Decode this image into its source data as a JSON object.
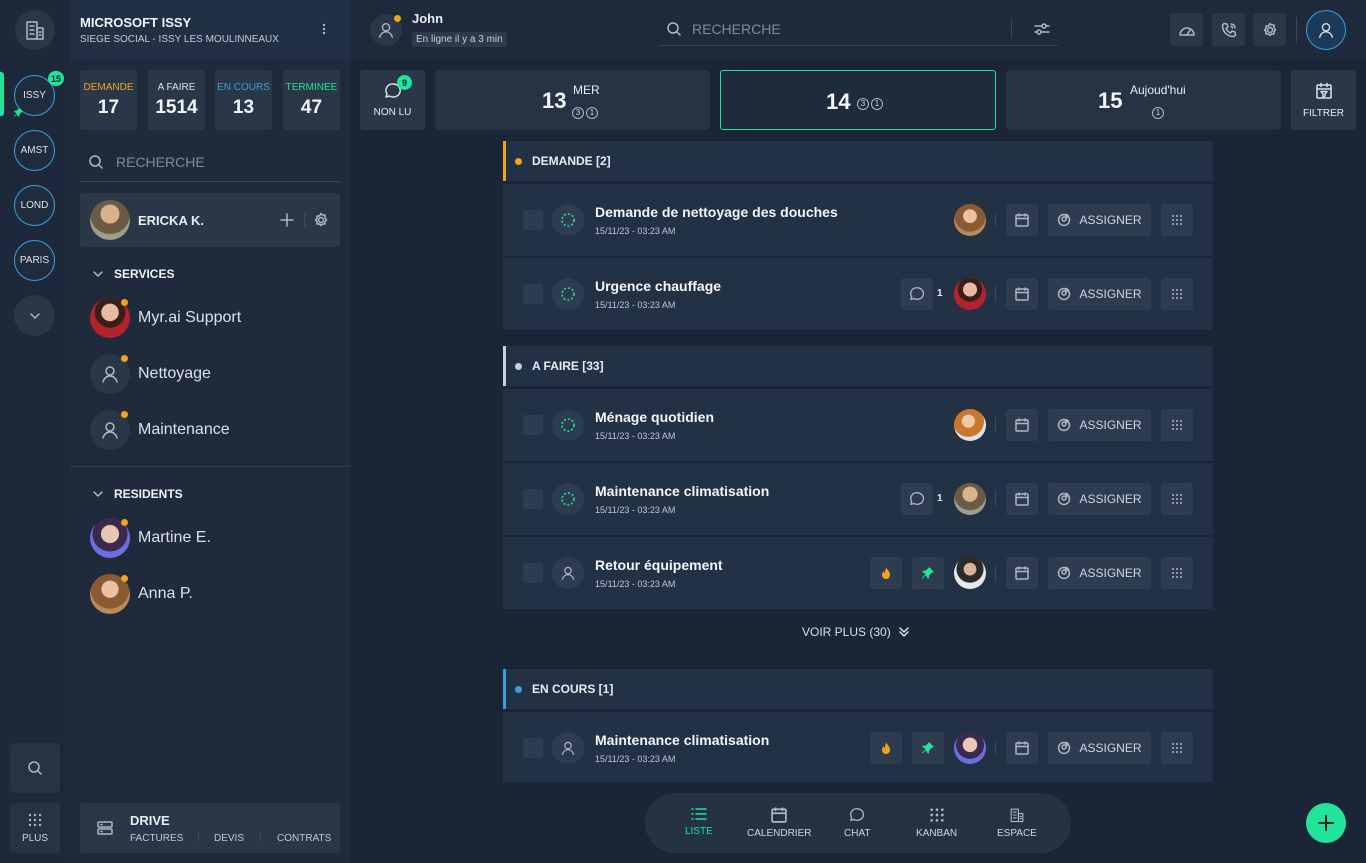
{
  "org": {
    "name": "MICROSOFT ISSY",
    "subtitle": "SIEGE SOCIAL - ISSY LES MOULINNEAUX"
  },
  "rail": {
    "sites": [
      {
        "label": "ISSY",
        "badge": "15",
        "active": true
      },
      {
        "label": "AMST"
      },
      {
        "label": "LOND"
      },
      {
        "label": "PARIS"
      }
    ],
    "plus_label": "PLUS"
  },
  "stats": [
    {
      "label": "DEMANDE",
      "value": "17",
      "color": "#f6a21e"
    },
    {
      "label": "A FAIRE",
      "value": "1514",
      "color": "#dbe1e8"
    },
    {
      "label": "EN COURS",
      "value": "13",
      "color": "#3a9fe0"
    },
    {
      "label": "TERMINEE",
      "value": "47",
      "color": "#21e39a"
    }
  ],
  "sidebar": {
    "search_placeholder": "RECHERCHE",
    "user": "ERICKA K.",
    "services_title": "SERVICES",
    "services": [
      "Myr.ai Support",
      "Nettoyage",
      "Maintenance"
    ],
    "residents_title": "RESIDENTS",
    "residents": [
      "Martine E.",
      "Anna P."
    ]
  },
  "drive": {
    "title": "DRIVE",
    "links": [
      "FACTURES",
      "DEVIS",
      "CONTRATS"
    ]
  },
  "topbar": {
    "user_name": "John",
    "user_status": "En ligne il y a 3 min",
    "search_placeholder": "RECHERCHE"
  },
  "nonlu": {
    "label": "NON LU",
    "badge": "9"
  },
  "days": [
    {
      "num": "13",
      "name": "MER",
      "counts": [
        "3",
        "1"
      ]
    },
    {
      "num": "14",
      "name": "",
      "counts": [
        "3",
        "1"
      ],
      "selected": true
    },
    {
      "num": "15",
      "name": "Aujoud'hui",
      "counts": [
        "1"
      ]
    }
  ],
  "filter_label": "FILTRER",
  "groups": {
    "demande": {
      "title": "DEMANDE [2]",
      "color": "#f6a21e"
    },
    "afaire": {
      "title": "A FAIRE [33]",
      "color": "#c8d0da"
    },
    "encours": {
      "title": "EN COURS [1]",
      "color": "#3a9fe0"
    }
  },
  "assign_label": "ASSIGNER",
  "tasks": [
    {
      "title": "Demande de nettoyage des douches",
      "date": "15/11/23 - 03:23 AM"
    },
    {
      "title": "Urgence chauffage",
      "date": "15/11/23 - 03:23 AM",
      "comments": "1"
    },
    {
      "title": "Ménage quotidien",
      "date": "15/11/23 - 03:23 AM"
    },
    {
      "title": "Maintenance climatisation",
      "date": "15/11/23 - 03:23 AM",
      "comments": "1"
    },
    {
      "title": "Retour équipement",
      "date": "15/11/23 - 03:23 AM"
    },
    {
      "title": "Maintenance climatisation",
      "date": "15/11/23 - 03:23 AM"
    }
  ],
  "voir_plus": "VOIR PLUS (30)",
  "bottom_nav": [
    "LISTE",
    "CALENDRIER",
    "CHAT",
    "KANBAN",
    "ESPACE"
  ],
  "colors": {
    "accent": "#21e39a",
    "blue": "#3a9fe0",
    "orange": "#f6a21e"
  }
}
